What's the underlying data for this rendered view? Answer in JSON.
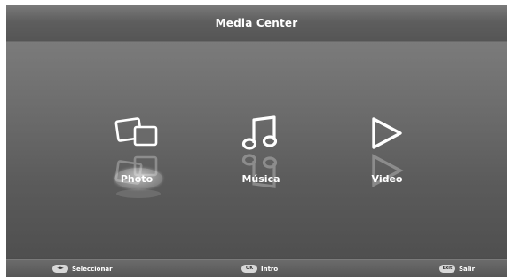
{
  "header": {
    "title": "Media Center"
  },
  "menu": {
    "items": [
      {
        "label": "Photo",
        "icon": "photo-icon",
        "selected": true
      },
      {
        "label": "Música",
        "icon": "music-note-icon",
        "selected": false
      },
      {
        "label": "Video",
        "icon": "play-icon",
        "selected": false
      }
    ]
  },
  "footer": {
    "hints": [
      {
        "key": "◄►",
        "label": "Seleccionar"
      },
      {
        "key": "OK",
        "label": "Intro"
      },
      {
        "key": "Exit",
        "label": "Salir"
      }
    ]
  },
  "colors": {
    "text": "#ffffff",
    "background_top": "#7b7b7b",
    "background_bottom": "#4f4f4f",
    "selection": "#9e9e9e"
  }
}
